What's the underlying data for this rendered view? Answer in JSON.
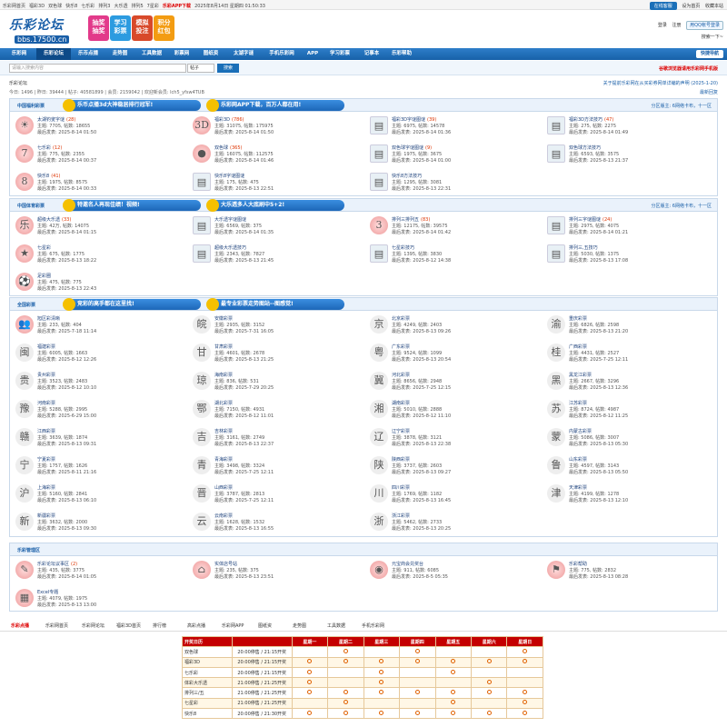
{
  "topbar": {
    "links": [
      "乐彩网首页",
      "福彩3D",
      "双色球",
      "快乐8",
      "七乐彩",
      "排列3",
      "大乐透",
      "排列5",
      "7星彩"
    ],
    "app": "乐彩APP下载",
    "datetime": "2025年8月14日 星期四 01:50:33",
    "client": "在线客服",
    "home": "设为首页",
    "fav": "收藏本站"
  },
  "header": {
    "logo_text": "乐彩论坛",
    "logo_sub": "bbs.17500.cn",
    "badges": [
      "抽奖 抽奖",
      "学习 彩票",
      "模拟 投注",
      "积分 红包"
    ],
    "login": "登录",
    "register": "注册",
    "qq": "用QQ帐号登录",
    "search_ph": "搜索一下~"
  },
  "nav": {
    "items": [
      "乐彩网",
      "乐彩论坛",
      "乐币点播",
      "走势图",
      "工具数据",
      "彩票网",
      "图纸资",
      "太湖字谜",
      "手机乐彩网",
      "APP",
      "学习彩票",
      "记事本",
      "乐彩帮助"
    ],
    "guide": "快捷导航"
  },
  "search": {
    "placeholder": "请输入搜索内容",
    "select": "帖子",
    "button": "搜索",
    "warn": "谷歌浏览器请用乐彩网手机版"
  },
  "crumb": {
    "path": "乐彩论坛",
    "stats": "今日: 1496 | 昨日: 39444 | 帖子: 40581899 | 会员: 2159042 | 欢迎新会员: lch5_yfsw4TUB",
    "notice": "关于提前乐彩网在从买彩券网单详编的声明 (2025-1-20)",
    "latest": "最新回复"
  },
  "sections": [
    {
      "title": "中国福利彩票",
      "right": "分区版主: 6网络卡布，十一区",
      "banners": [
        "乐币点播3d大神稳居排行冠军!",
        "乐彩网APP下载，百万人都在用!"
      ],
      "forums": [
        {
          "name": "太湖钓叟字谜",
          "cnt": "(28)",
          "stat": "主题: 7705, 帖数: 18655",
          "last": "最后发表: 2025-8-14 01:50",
          "icon": "☀"
        },
        {
          "name": "福彩3D",
          "cnt": "(786)",
          "stat": "主题: 31075, 帖数: 175975",
          "last": "最后发表: 2025-8-14 01:50",
          "icon": "3D"
        },
        {
          "name": "福彩3D字谜图谜",
          "cnt": "(39)",
          "stat": "主题: 6975, 帖数: 14578",
          "last": "最后发表: 2025-8-14 01:36",
          "icon": "▤"
        },
        {
          "name": "福彩3D方法技巧",
          "cnt": "(47)",
          "stat": "主题: 275, 帖数: 2275",
          "last": "最后发表: 2025-8-14 01:49",
          "icon": "▤"
        },
        {
          "name": "七乐彩",
          "cnt": "(12)",
          "stat": "主题: 775, 帖数: 2355",
          "last": "最后发表: 2025-8-14 00:37",
          "icon": "7"
        },
        {
          "name": "双色球",
          "cnt": "(365)",
          "stat": "主题: 16075, 帖数: 112575",
          "last": "最后发表: 2025-8-14 01:46",
          "icon": "●"
        },
        {
          "name": "双色球字谜图谜",
          "cnt": "(9)",
          "stat": "主题: 1975, 帖数: 3675",
          "last": "最后发表: 2025-8-14 01:00",
          "icon": "▤"
        },
        {
          "name": "双色球方法技巧",
          "cnt": "",
          "stat": "主题: 6593, 帖数: 3575",
          "last": "最后发表: 2025-8-13 21:37",
          "icon": "▤"
        },
        {
          "name": "快乐8",
          "cnt": "(41)",
          "stat": "主题: 1975, 帖数: 8575",
          "last": "最后发表: 2025-8-14 00:33",
          "icon": "8"
        },
        {
          "name": "快乐8字谜图谜",
          "cnt": "",
          "stat": "主题: 175, 帖数: 475",
          "last": "最后发表: 2025-8-13 22:51",
          "icon": "▤"
        },
        {
          "name": "快乐8方法技巧",
          "cnt": "",
          "stat": "主题: 1295, 帖数: 3081",
          "last": "最后发表: 2025-8-13 22:31",
          "icon": "▤"
        }
      ]
    },
    {
      "title": "中国体育彩票",
      "right": "分区版主: 6网络卡布，十一区",
      "banners": [
        "特邀名人再现佳绩！视频!",
        "大乐透多人大底刷中5+2!"
      ],
      "forums": [
        {
          "name": "超级大乐透",
          "cnt": "(33)",
          "stat": "主题: 42万, 帖数: 14075",
          "last": "最后发表: 2025-8-14 01:15",
          "icon": "乐"
        },
        {
          "name": "大乐透字谜图谜",
          "cnt": "",
          "stat": "主题: 6569, 帖数: 375",
          "last": "最后发表: 2025-8-14 01:35",
          "icon": "▤"
        },
        {
          "name": "排列三排列五",
          "cnt": "(83)",
          "stat": "主题: 12175, 帖数: 39575",
          "last": "最后发表: 2025-8-14 01:42",
          "icon": "3"
        },
        {
          "name": "排列三字谜图谜",
          "cnt": "(24)",
          "stat": "主题: 2975, 帖数: 4075",
          "last": "最后发表: 2025-8-14 01:21",
          "icon": "▤"
        },
        {
          "name": "七星彩",
          "cnt": "",
          "stat": "主题: 675, 帖数: 1775",
          "last": "最后发表: 2025-8-13 18:22",
          "icon": "★"
        },
        {
          "name": "超级大乐透技巧",
          "cnt": "",
          "stat": "主题: 2343, 帖数: 7827",
          "last": "最后发表: 2025-8-13 21:45",
          "icon": "▤"
        },
        {
          "name": "七星彩技巧",
          "cnt": "",
          "stat": "主题: 1395, 帖数: 3830",
          "last": "最后发表: 2025-8-12 14:38",
          "icon": "▤"
        },
        {
          "name": "排列三,五技巧",
          "cnt": "",
          "stat": "主题: 5030, 帖数: 1375",
          "last": "最后发表: 2025-8-13 17:08",
          "icon": "▤"
        },
        {
          "name": "足彩圈",
          "cnt": "",
          "stat": "主题: 475, 帖数: 775",
          "last": "最后发表: 2025-8-13 22:43",
          "icon": "⚽"
        }
      ]
    },
    {
      "title": "全国彩票",
      "right": "",
      "banners": [
        "竞彩的高手都在这里找!",
        "最专业彩票走势图站--图感觉!"
      ],
      "forums": [
        {
          "name": "旭区彩清晰",
          "cnt": "",
          "stat": "主题: 233, 帖数: 404",
          "last": "最后发表: 2025-7-18 11:14",
          "icon": "👥"
        },
        {
          "name": "安徽彩票",
          "cnt": "",
          "stat": "主题: 2935, 帖数: 3152",
          "last": "最后发表: 2025-7-31 16:05",
          "icon": "皖"
        },
        {
          "name": "北京彩票",
          "cnt": "",
          "stat": "主题: 4249, 帖数: 2403",
          "last": "最后发表: 2025-8-13 09:26",
          "icon": "京"
        },
        {
          "name": "重庆彩票",
          "cnt": "",
          "stat": "主题: 6826, 帖数: 2598",
          "last": "最后发表: 2025-8-13 21:20",
          "icon": "渝"
        },
        {
          "name": "福建彩票",
          "cnt": "",
          "stat": "主题: 6005, 帖数: 1663",
          "last": "最后发表: 2025-8-12 12:26",
          "icon": "闽"
        },
        {
          "name": "甘肃彩票",
          "cnt": "",
          "stat": "主题: 4601, 帖数: 2678",
          "last": "最后发表: 2025-8-13 21:25",
          "icon": "甘"
        },
        {
          "name": "广东彩票",
          "cnt": "",
          "stat": "主题: 9524, 帖数: 1099",
          "last": "最后发表: 2025-8-13 20:54",
          "icon": "粤"
        },
        {
          "name": "广西彩票",
          "cnt": "",
          "stat": "主题: 4431, 帖数: 2527",
          "last": "最后发表: 2025-7-25 12:11",
          "icon": "桂"
        },
        {
          "name": "贵州彩票",
          "cnt": "",
          "stat": "主题: 3523, 帖数: 2483",
          "last": "最后发表: 2025-8-12 10:10",
          "icon": "贵"
        },
        {
          "name": "海南彩票",
          "cnt": "",
          "stat": "主题: 836, 帖数: 531",
          "last": "最后发表: 2025-7-29 20:25",
          "icon": "琼"
        },
        {
          "name": "河北彩票",
          "cnt": "",
          "stat": "主题: 8656, 帖数: 2948",
          "last": "最后发表: 2025-7-25 12:15",
          "icon": "冀"
        },
        {
          "name": "黑龙江彩票",
          "cnt": "",
          "stat": "主题: 2667, 帖数: 3296",
          "last": "最后发表: 2025-8-13 12:36",
          "icon": "黑"
        },
        {
          "name": "河南彩票",
          "cnt": "",
          "stat": "主题: 5288, 帖数: 2995",
          "last": "最后发表: 2025-6-29 15:00",
          "icon": "豫"
        },
        {
          "name": "湖北彩票",
          "cnt": "",
          "stat": "主题: 7150, 帖数: 4931",
          "last": "最后发表: 2025-8-12 11:01",
          "icon": "鄂"
        },
        {
          "name": "湖南彩票",
          "cnt": "",
          "stat": "主题: 5010, 帖数: 2888",
          "last": "最后发表: 2025-8-12 11:10",
          "icon": "湘"
        },
        {
          "name": "江苏彩票",
          "cnt": "",
          "stat": "主题: 8724, 帖数: 4987",
          "last": "最后发表: 2025-8-12 11:25",
          "icon": "苏"
        },
        {
          "name": "江西彩票",
          "cnt": "",
          "stat": "主题: 3639, 帖数: 1874",
          "last": "最后发表: 2025-8-13 09:31",
          "icon": "赣"
        },
        {
          "name": "吉林彩票",
          "cnt": "",
          "stat": "主题: 3161, 帖数: 2749",
          "last": "最后发表: 2025-8-13 22:37",
          "icon": "吉"
        },
        {
          "name": "辽宁彩票",
          "cnt": "",
          "stat": "主题: 3878, 帖数: 3121",
          "last": "最后发表: 2025-8-13 22:38",
          "icon": "辽"
        },
        {
          "name": "内蒙古彩票",
          "cnt": "",
          "stat": "主题: 5086, 帖数: 3007",
          "last": "最后发表: 2025-8-13 05:30",
          "icon": "蒙"
        },
        {
          "name": "宁夏彩票",
          "cnt": "",
          "stat": "主题: 1757, 帖数: 1626",
          "last": "最后发表: 2025-8-11 21:16",
          "icon": "宁"
        },
        {
          "name": "青海彩票",
          "cnt": "",
          "stat": "主题: 3498, 帖数: 3324",
          "last": "最后发表: 2025-7-25 12:11",
          "icon": "青"
        },
        {
          "name": "陕西彩票",
          "cnt": "",
          "stat": "主题: 3737, 帖数: 2603",
          "last": "最后发表: 2025-8-13 09:27",
          "icon": "陕"
        },
        {
          "name": "山东彩票",
          "cnt": "",
          "stat": "主题: 4597, 帖数: 3143",
          "last": "最后发表: 2025-8-13 05:50",
          "icon": "鲁"
        },
        {
          "name": "上海彩票",
          "cnt": "",
          "stat": "主题: 5160, 帖数: 2841",
          "last": "最后发表: 2025-8-13 06:10",
          "icon": "沪"
        },
        {
          "name": "山西彩票",
          "cnt": "",
          "stat": "主题: 3787, 帖数: 2813",
          "last": "最后发表: 2025-7-25 12:11",
          "icon": "晋"
        },
        {
          "name": "四川彩票",
          "cnt": "",
          "stat": "主题: 1769, 帖数: 1182",
          "last": "最后发表: 2025-8-13 16:45",
          "icon": "川"
        },
        {
          "name": "天津彩票",
          "cnt": "",
          "stat": "主题: 4199, 帖数: 1278",
          "last": "最后发表: 2025-8-13 12:10",
          "icon": "津"
        },
        {
          "name": "新疆彩票",
          "cnt": "",
          "stat": "主题: 3632, 帖数: 2000",
          "last": "最后发表: 2025-8-13 09:30",
          "icon": "新"
        },
        {
          "name": "云南彩票",
          "cnt": "",
          "stat": "主题: 1628, 帖数: 1532",
          "last": "最后发表: 2025-8-13 16:55",
          "icon": "云"
        },
        {
          "name": "浙江彩票",
          "cnt": "",
          "stat": "主题: 5462, 帖数: 2733",
          "last": "最后发表: 2025-8-13 20:25",
          "icon": "浙"
        }
      ]
    },
    {
      "title": "乐彩管理区",
      "right": "",
      "banners": [],
      "forums": [
        {
          "name": "乐彩论坛议事区",
          "cnt": "(2)",
          "stat": "主题: 435, 帖数: 3775",
          "last": "最后发表: 2025-8-14 01:05",
          "icon": "✎"
        },
        {
          "name": "实体店号站",
          "cnt": "",
          "stat": "主题: 235, 帖数: 375",
          "last": "最后发表: 2025-8-13 23:51",
          "icon": "⌂"
        },
        {
          "name": "元宝商会兑奖台",
          "cnt": "",
          "stat": "主题: 911, 帖数: 6085",
          "last": "最后发表: 2025-8-5 05:35",
          "icon": "◉"
        },
        {
          "name": "乐彩帮助",
          "cnt": "",
          "stat": "主题: 775, 帖数: 2832",
          "last": "最后发表: 2025-8-13 08:28",
          "icon": "⚑"
        },
        {
          "name": "Excel专题",
          "cnt": "",
          "stat": "主题: 4079, 帖数: 1975",
          "last": "最后发表: 2025-8-13 13:00",
          "icon": "▦"
        }
      ]
    }
  ],
  "footnav": [
    "乐彩点播",
    "乐彩网首页",
    "乐彩网论坛",
    "福彩3D首页",
    "排行榜",
    "高彩点播",
    "乐彩网APP",
    "图纸资",
    "走势图",
    "工具数据",
    "手机乐彩网"
  ],
  "schedule": {
    "header": [
      "开奖日历",
      "",
      "星期一",
      "星期二",
      "星期三",
      "星期四",
      "星期五",
      "星期六",
      "星期日"
    ],
    "rows": [
      {
        "name": "双色球",
        "time": "20:00停售 / 21:15开奖",
        "days": [
          0,
          1,
          0,
          1,
          0,
          0,
          1
        ]
      },
      {
        "name": "福彩3D",
        "time": "20:00停售 / 21:15开奖",
        "days": [
          1,
          1,
          1,
          1,
          1,
          1,
          1
        ]
      },
      {
        "name": "七乐彩",
        "time": "20:00停售 / 21:15开奖",
        "days": [
          1,
          0,
          1,
          0,
          1,
          0,
          0
        ]
      },
      {
        "name": "体彩大乐透",
        "time": "21:00停售 / 21:25开奖",
        "days": [
          1,
          0,
          1,
          0,
          0,
          1,
          0
        ]
      },
      {
        "name": "排列三/五",
        "time": "21:00停售 / 21:25开奖",
        "days": [
          1,
          1,
          1,
          1,
          1,
          1,
          1
        ]
      },
      {
        "name": "七星彩",
        "time": "21:00停售 / 21:25开奖",
        "days": [
          0,
          1,
          0,
          0,
          1,
          0,
          1
        ]
      },
      {
        "name": "快乐8",
        "time": "20:00停售 / 21:30开奖",
        "days": [
          1,
          1,
          1,
          1,
          1,
          1,
          1
        ]
      }
    ]
  }
}
